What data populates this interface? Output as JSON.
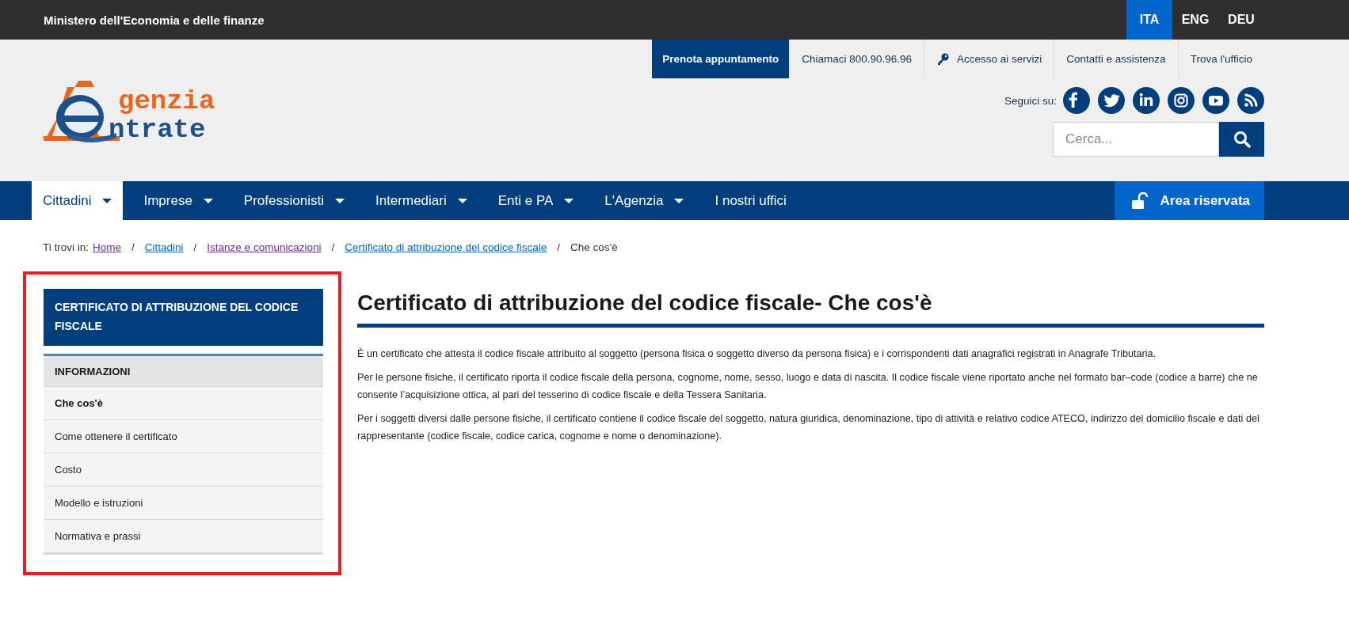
{
  "top_bar": {
    "title": "Ministero dell'Economia e delle finanze",
    "languages": [
      {
        "label": "ITA",
        "selected": true
      },
      {
        "label": "ENG",
        "selected": false
      },
      {
        "label": "DEU",
        "selected": false
      }
    ]
  },
  "utility_links": [
    {
      "label": "Prenota appuntamento",
      "kind": "primary"
    },
    {
      "label": "Chiamaci 800.90.96.96",
      "kind": "plain"
    },
    {
      "label": "Accesso ai servizi",
      "kind": "key"
    },
    {
      "label": "Contatti e assistenza",
      "kind": "plain"
    },
    {
      "label": "Trova l'ufficio",
      "kind": "plain"
    }
  ],
  "logo": {
    "line_1": "genzia",
    "line_2": "ntrate"
  },
  "social": {
    "label": "Seguici su:"
  },
  "search": {
    "placeholder": "Cerca..."
  },
  "nav": {
    "items": [
      {
        "label": "Cittadini",
        "selected": true,
        "dropdown": true
      },
      {
        "label": "Imprese",
        "selected": false,
        "dropdown": true
      },
      {
        "label": "Professionisti",
        "selected": false,
        "dropdown": true
      },
      {
        "label": "Intermediari",
        "selected": false,
        "dropdown": true
      },
      {
        "label": "Enti e PA",
        "selected": false,
        "dropdown": true
      },
      {
        "label": "L'Agenzia",
        "selected": false,
        "dropdown": true
      },
      {
        "label": "I nostri uffici",
        "selected": false,
        "dropdown": false
      }
    ],
    "reserved_area": "Area riservata"
  },
  "breadcrumb": {
    "label": "Ti trovi in:",
    "separator": "/",
    "items": [
      {
        "label": "Home",
        "kind": "link",
        "visited": true
      },
      {
        "label": "Cittadini",
        "kind": "link",
        "visited": false
      },
      {
        "label": "Istanze e comunicazioni",
        "kind": "link",
        "visited": true
      },
      {
        "label": "Certificato di attribuzione del codice fiscale",
        "kind": "link",
        "visited": false
      },
      {
        "label": "Che cos'è",
        "kind": "current"
      }
    ]
  },
  "sidebar": {
    "title": "CERTIFICATO DI ATTRIBUZIONE DEL CODICE FISCALE",
    "section": "INFORMAZIONI",
    "items": [
      {
        "label": "Che cos'è",
        "selected": true
      },
      {
        "label": "Come ottenere il certificato",
        "selected": false
      },
      {
        "label": "Costo",
        "selected": false
      },
      {
        "label": "Modello e istruzioni",
        "selected": false
      },
      {
        "label": "Normativa e prassi",
        "selected": false
      }
    ]
  },
  "article": {
    "title": "Certificato di attribuzione del codice fiscale- Che cos'è",
    "paragraphs": [
      "È un certificato che attesta il codice fiscale attribuito al soggetto (persona fisica o soggetto diverso da persona fisica) e i corrispondenti dati anagrafici registrati in Anagrafe Tributaria.",
      "Per le persone fisiche, il certificato riporta il codice fiscale della persona, cognome, nome, sesso, luogo e data di nascita. Il codice fiscale viene riportato anche nel formato bar–code (codice a barre) che ne consente l’acquisizione ottica, al pari del tesserino di codice fiscale e della Tessera Sanitaria.",
      "Per i soggetti diversi dalle persone fisiche, il certificato contiene il codice fiscale del soggetto, natura giuridica, denominazione, tipo di attività e relativo codice ATECO, indirizzo del domicilio fiscale e dati del rappresentante (codice fiscale, codice carica, cognome e nome o denominazione)."
    ]
  }
}
